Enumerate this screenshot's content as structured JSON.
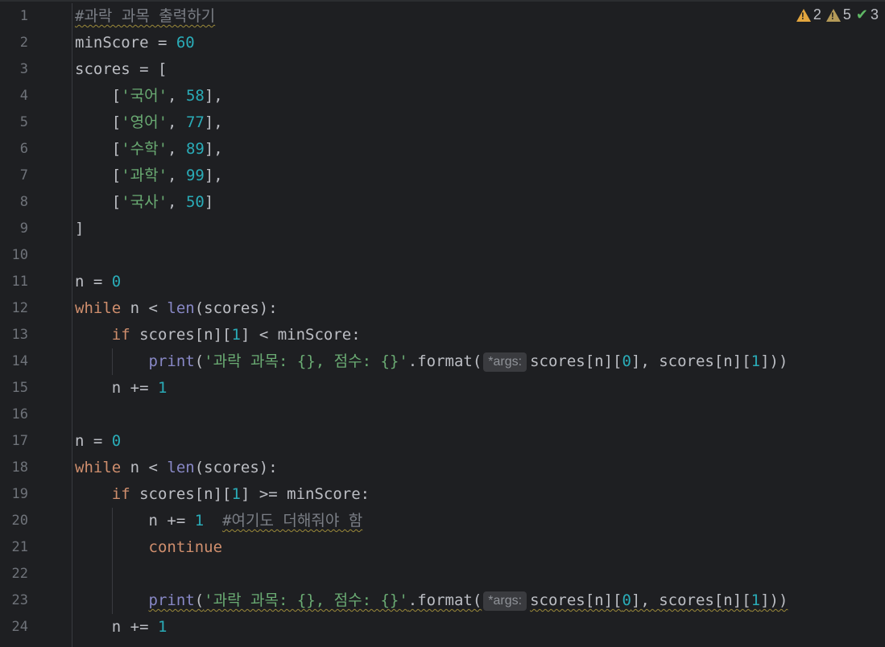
{
  "status": {
    "errors_count": "2",
    "warnings_count": "5",
    "ok_count": "3",
    "error_color": "#e2a53e",
    "warning_color": "#b49a58",
    "ok_color": "#5fb865"
  },
  "line_numbers": [
    "1",
    "2",
    "3",
    "4",
    "5",
    "6",
    "7",
    "8",
    "9",
    "10",
    "11",
    "12",
    "13",
    "14",
    "15",
    "16",
    "17",
    "18",
    "19",
    "20",
    "21",
    "22",
    "23",
    "24"
  ],
  "code": {
    "l1": {
      "comment": "#과락 과목 출력하기"
    },
    "l2": {
      "var": "minScore",
      "op": " = ",
      "num": "60"
    },
    "l3": {
      "text": "scores = ["
    },
    "l4": {
      "open": "    [",
      "str": "'국어'",
      "sep": ", ",
      "num": "58",
      "close": "],"
    },
    "l5": {
      "open": "    [",
      "str": "'영어'",
      "sep": ", ",
      "num": "77",
      "close": "],"
    },
    "l6": {
      "open": "    [",
      "str": "'수학'",
      "sep": ", ",
      "num": "89",
      "close": "],"
    },
    "l7": {
      "open": "    [",
      "str": "'과학'",
      "sep": ", ",
      "num": "99",
      "close": "],"
    },
    "l8": {
      "open": "    [",
      "str": "'국사'",
      "sep": ", ",
      "num": "50",
      "close": "]"
    },
    "l9": {
      "text": "]"
    },
    "l11": {
      "pre": "n = ",
      "num": "0"
    },
    "l12": {
      "kw": "while",
      "mid": " n < ",
      "fn": "len",
      "post": "(scores):"
    },
    "l13": {
      "indent": "    ",
      "kw": "if",
      "mid": " scores[n][",
      "num": "1",
      "post": "] < minScore:"
    },
    "l14": {
      "indent": "        ",
      "fn": "print",
      "paren": "(",
      "str": "'과락 과목: {}, 점수: {}'",
      "method": ".format(",
      "hint": "*args:",
      "a1": "scores[n][",
      "n0": "0",
      "a2": "], scores[n][",
      "n1": "1",
      "a3": "]))"
    },
    "l15": {
      "pre": "    n += ",
      "num": "1"
    },
    "l17": {
      "pre": "n = ",
      "num": "0"
    },
    "l18": {
      "kw": "while",
      "mid": " n < ",
      "fn": "len",
      "post": "(scores):"
    },
    "l19": {
      "indent": "    ",
      "kw": "if",
      "mid": " scores[n][",
      "num": "1",
      "post": "] >= minScore:"
    },
    "l20": {
      "pre": "        n += ",
      "num": "1",
      "gap": "  ",
      "comment": "#여기도 더해줘야 함"
    },
    "l21": {
      "indent": "        ",
      "kw": "continue"
    },
    "l23": {
      "indent": "        ",
      "fn": "print",
      "paren": "(",
      "str": "'과락 과목: {}, 점수: {}'",
      "method": ".format(",
      "hint": "*args:",
      "a1": "scores[n][",
      "n0": "0",
      "a2": "], scores[n][",
      "n1": "1",
      "a3": "]))"
    },
    "l24": {
      "pre": "    n += ",
      "num": "1"
    }
  }
}
